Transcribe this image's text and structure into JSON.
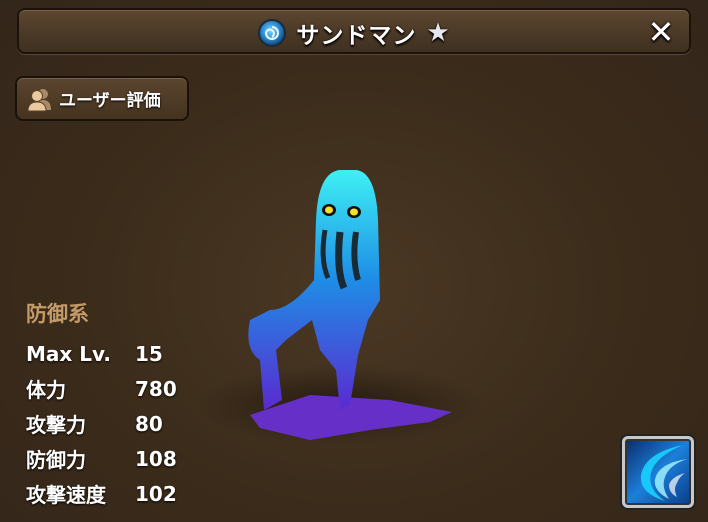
{
  "header": {
    "title": "サンドマン",
    "element_icon": "water-element-icon",
    "rarity_icon": "star-icon",
    "close_label": "✕"
  },
  "review_button": {
    "label": "ユーザー評価",
    "icon": "users-icon"
  },
  "monster": {
    "category": "防御系",
    "stats": [
      {
        "label": "Max Lv.",
        "value": "15"
      },
      {
        "label": "体力",
        "value": "780"
      },
      {
        "label": "攻撃力",
        "value": "80"
      },
      {
        "label": "防御力",
        "value": "108"
      },
      {
        "label": "攻撃速度",
        "value": "102"
      }
    ]
  },
  "skill": {
    "icon": "wave-slash-skill-icon"
  },
  "colors": {
    "background": "#3b2b1a",
    "category_text": "#c49a68",
    "monster_body": "#2aa8e8"
  }
}
